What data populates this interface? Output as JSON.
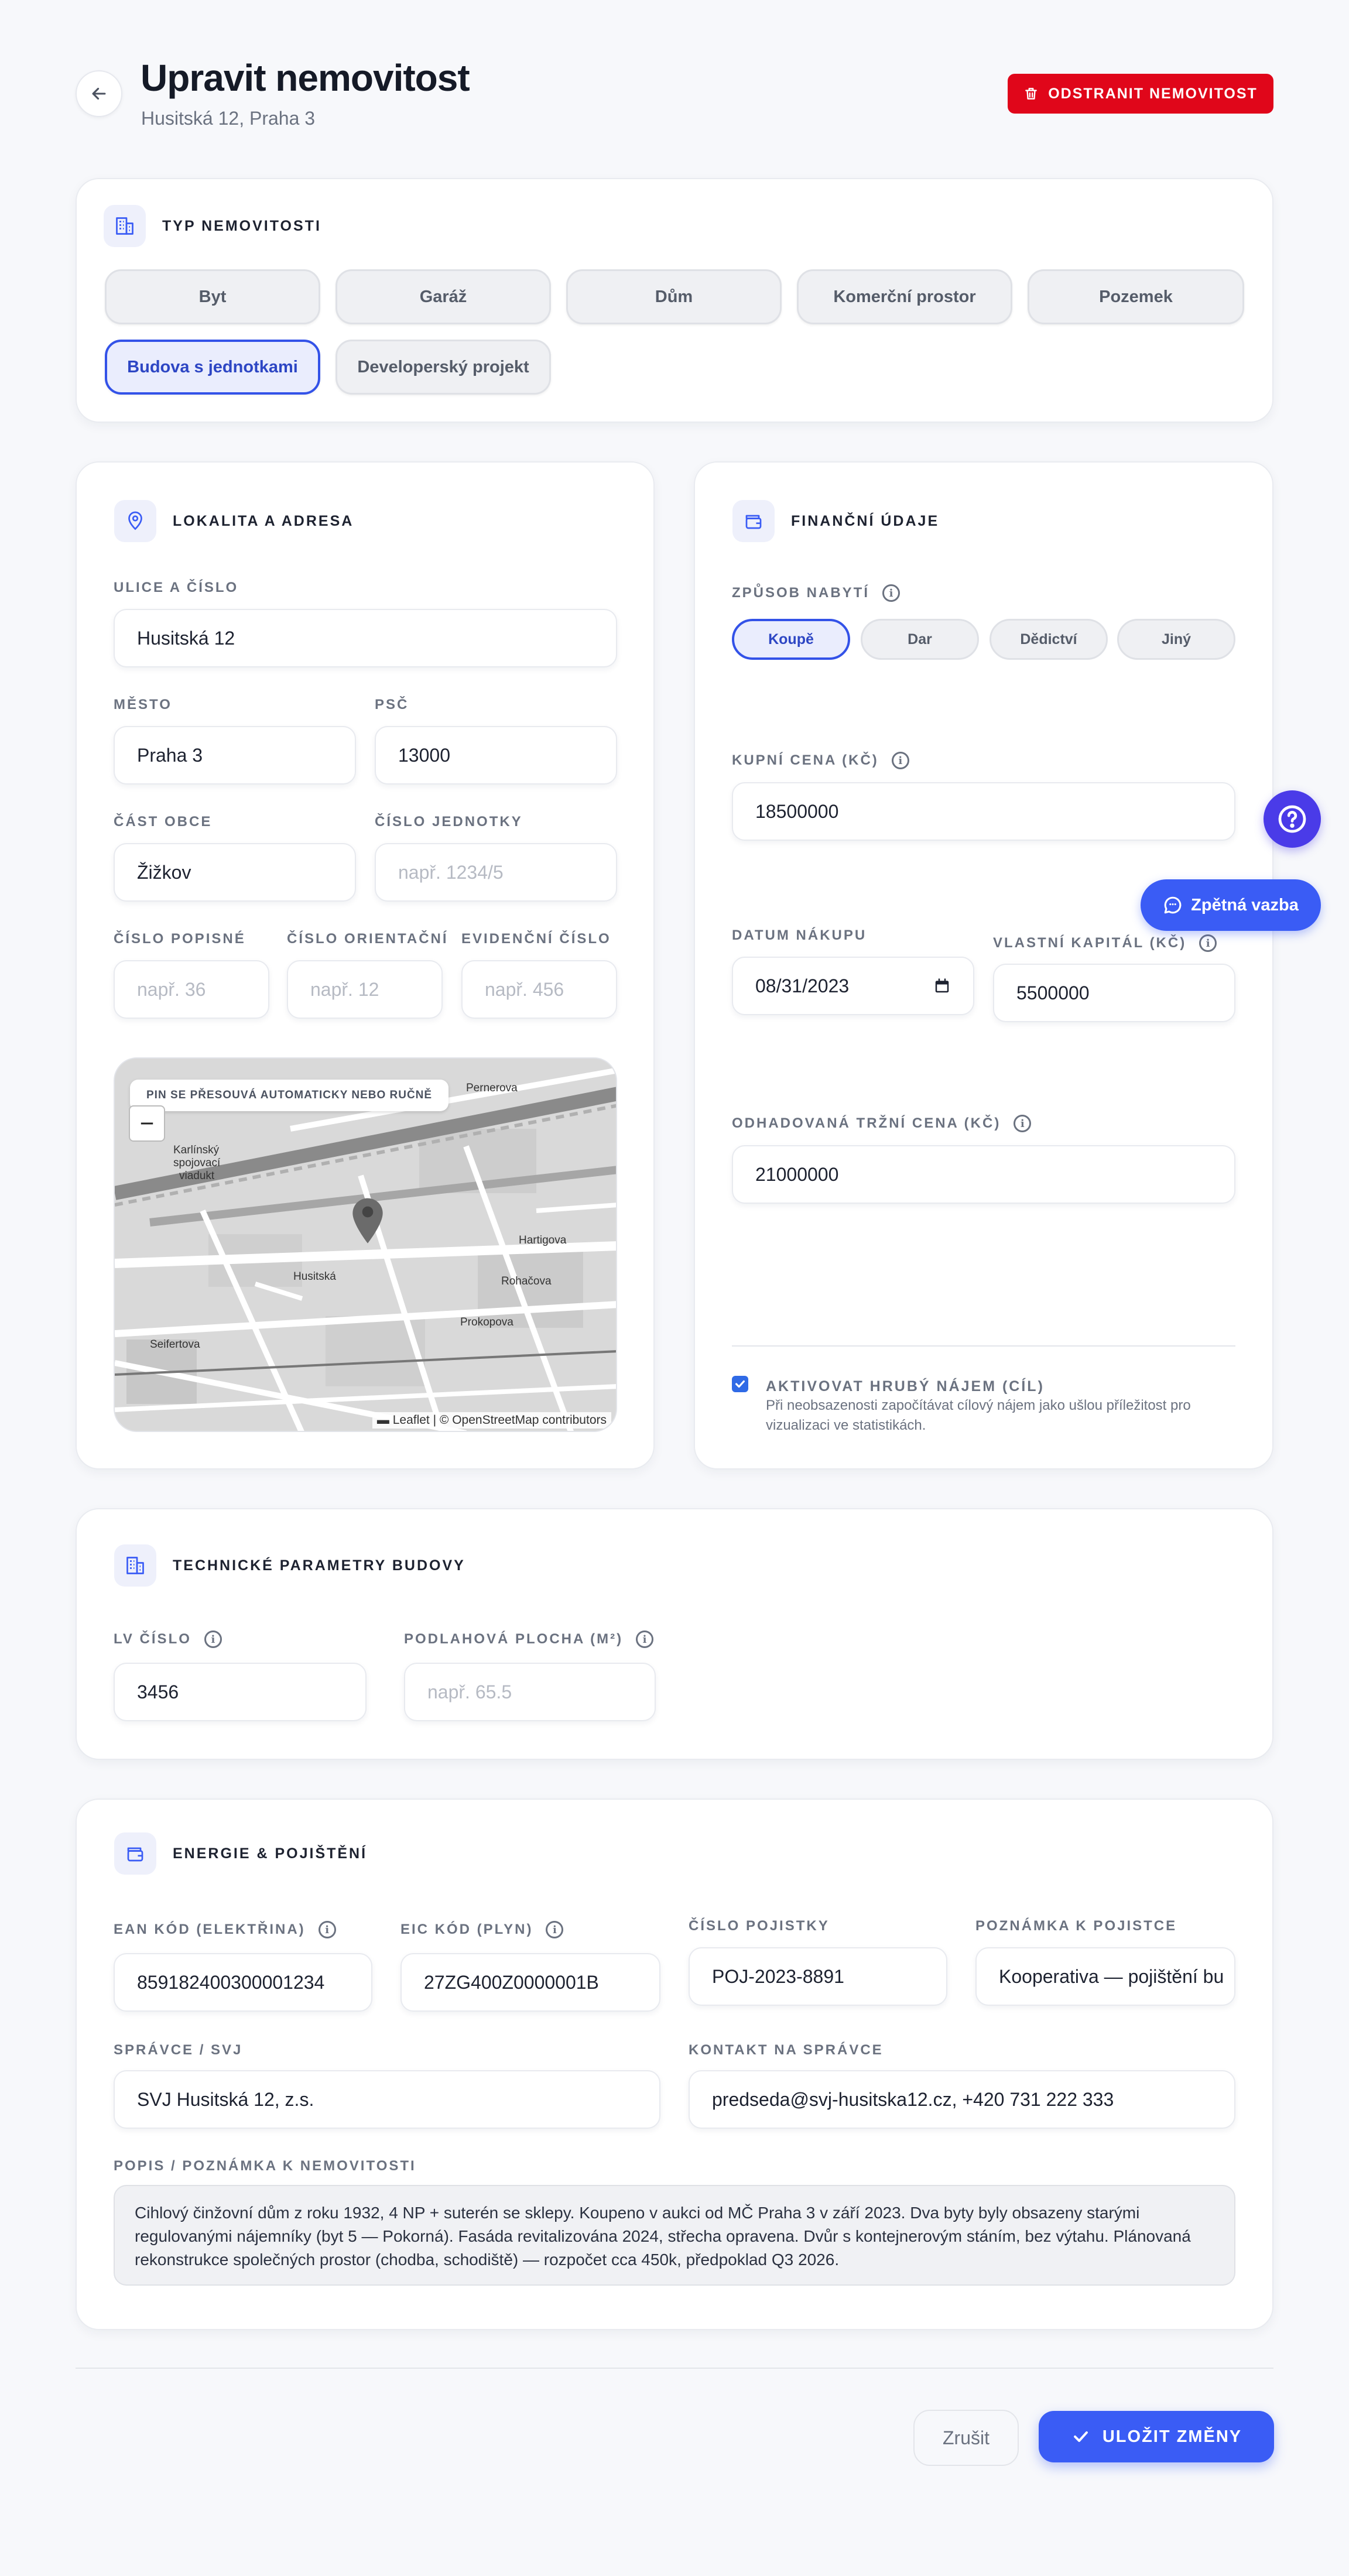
{
  "header": {
    "title": "Upravit nemovitost",
    "subtitle": "Husitská 12, Praha 3",
    "delete_label": "ODSTRANIT NEMOVITOST"
  },
  "type_section": {
    "title": "TYP NEMOVITOSTI",
    "options": [
      "Byt",
      "Garáž",
      "Dům",
      "Komerční prostor",
      "Pozemek",
      "Budova s jednotkami",
      "Developerský projekt"
    ],
    "selected": "Budova s jednotkami"
  },
  "location": {
    "title": "LOKALITA A ADRESA",
    "street_label": "ULICE A ČÍSLO",
    "street_value": "Husitská 12",
    "city_label": "MĚSTO",
    "city_value": "Praha 3",
    "zip_label": "PSČ",
    "zip_value": "13000",
    "district_label": "ČÁST OBCE",
    "district_value": "Žižkov",
    "unit_label": "ČÍSLO JEDNOTKY",
    "unit_placeholder": "např. 1234/5",
    "popisne_label": "ČÍSLO POPISNÉ",
    "popisne_placeholder": "např. 36",
    "orientacni_label": "ČÍSLO ORIENTAČNÍ",
    "orientacni_placeholder": "např. 12",
    "evidencni_label": "EVIDENČNÍ ČÍSLO",
    "evidencni_placeholder": "např. 456",
    "map": {
      "note": "PIN SE PŘESOUVÁ AUTOMATICKY NEBO RUČNĚ",
      "zoom_out": "−",
      "attribution": "▬ Leaflet | © OpenStreetMap contributors",
      "labels": [
        "Karlínský",
        "spojovací",
        "viadukt",
        "Husitská",
        "Seifertova",
        "Rohačova",
        "Prokopova",
        "Pernerova",
        "Hartigova"
      ]
    }
  },
  "finance": {
    "title": "FINANČNÍ ÚDAJE",
    "acquisition_label": "ZPŮSOB NABYTÍ",
    "acquisition_options": [
      "Koupě",
      "Dar",
      "Dědictví",
      "Jiný"
    ],
    "acquisition_selected": "Koupě",
    "price_label": "KUPNÍ CENA (KČ)",
    "price_value": "18500000",
    "date_label": "DATUM NÁKUPU",
    "date_value": "08/31/2023",
    "equity_label": "VLASTNÍ KAPITÁL (KČ)",
    "equity_value": "5500000",
    "market_label": "ODHADOVANÁ TRŽNÍ CENA (KČ)",
    "market_value": "21000000",
    "gross_rent_title": "AKTIVOVAT HRUBÝ NÁJEM (CÍL)",
    "gross_rent_desc_1": "Při neobsazenosti započítávat cílový nájem jako ušlou příležitost pro",
    "gross_rent_desc_2": "vizualizaci ve statistikách.",
    "gross_rent_checked": true
  },
  "technical": {
    "title": "TECHNICKÉ PARAMETRY BUDOVY",
    "lv_label": "LV ČÍSLO",
    "lv_value": "3456",
    "area_label": "PODLAHOVÁ PLOCHA (M²)",
    "area_placeholder": "např. 65.5"
  },
  "energy": {
    "title": "ENERGIE & POJIŠTĚNÍ",
    "ean_label": "EAN KÓD (ELEKTŘINA)",
    "ean_value": "859182400300001234",
    "eic_label": "EIC KÓD (PLYN)",
    "eic_value": "27ZG400Z0000001B",
    "policy_label": "ČÍSLO POJISTKY",
    "policy_value": "POJ-2023-8891",
    "policy_note_label": "POZNÁMKA K POJISTCE",
    "policy_note_value": "Kooperativa — pojištění bu",
    "manager_label": "SPRÁVCE / SVJ",
    "manager_value": "SVJ Husitská 12, z.s.",
    "contact_label": "KONTAKT NA SPRÁVCE",
    "contact_value": "predseda@svj-husitska12.cz, +420 731 222 333",
    "description_label": "POPIS / POZNÁMKA K NEMOVITOSTI",
    "description_value": "Cihlový činžovní dům z roku 1932, 4 NP + suterén se sklepy. Koupeno v aukci od MČ Praha 3 v září 2023. Dva byty byly obsazeny starými regulovanými nájemníky (byt 5 — Pokorná). Fasáda revitalizována 2024, střecha opravena. Dvůr s kontejnerovým stáním, bez výtahu. Plánovaná rekonstrukce společných prostor (chodba, schodiště) — rozpočet cca 450k, předpoklad Q3 2026."
  },
  "footer": {
    "cancel_label": "Zrušit",
    "save_label": "ULOŽIT ZMĚNY"
  },
  "floating": {
    "help_icon": "question-icon",
    "feedback_label": "Zpětná vazba"
  },
  "colors": {
    "accent": "#3a5cf5",
    "danger": "#e0061a",
    "help": "#4a3be8"
  }
}
